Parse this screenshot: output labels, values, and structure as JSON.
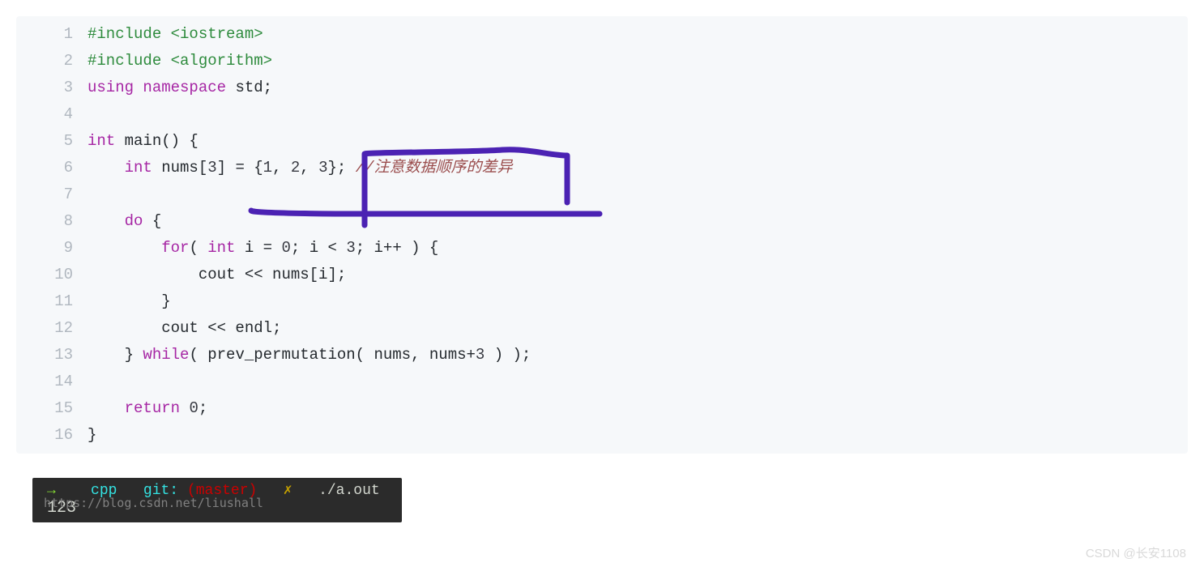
{
  "code": {
    "lines": [
      {
        "n": "1",
        "segs": [
          {
            "cls": "preproc",
            "t": "#include <iostream>"
          }
        ]
      },
      {
        "n": "2",
        "segs": [
          {
            "cls": "preproc",
            "t": "#include <algorithm>"
          }
        ]
      },
      {
        "n": "3",
        "segs": [
          {
            "cls": "kw",
            "t": "using"
          },
          {
            "cls": "",
            "t": " "
          },
          {
            "cls": "kw",
            "t": "namespace"
          },
          {
            "cls": "",
            "t": " std;"
          }
        ]
      },
      {
        "n": "4",
        "segs": [
          {
            "cls": "",
            "t": ""
          }
        ]
      },
      {
        "n": "5",
        "segs": [
          {
            "cls": "type",
            "t": "int"
          },
          {
            "cls": "",
            "t": " main() {"
          }
        ]
      },
      {
        "n": "6",
        "segs": [
          {
            "cls": "",
            "t": "    "
          },
          {
            "cls": "type",
            "t": "int"
          },
          {
            "cls": "",
            "t": " nums["
          },
          {
            "cls": "num",
            "t": "3"
          },
          {
            "cls": "",
            "t": "] = {"
          },
          {
            "cls": "num",
            "t": "1"
          },
          {
            "cls": "",
            "t": ", "
          },
          {
            "cls": "num",
            "t": "2"
          },
          {
            "cls": "",
            "t": ", "
          },
          {
            "cls": "num",
            "t": "3"
          },
          {
            "cls": "",
            "t": "}; "
          },
          {
            "cls": "cmt",
            "t": "//注意数据顺序的差异"
          }
        ]
      },
      {
        "n": "7",
        "segs": [
          {
            "cls": "",
            "t": ""
          }
        ]
      },
      {
        "n": "8",
        "segs": [
          {
            "cls": "",
            "t": "    "
          },
          {
            "cls": "kw",
            "t": "do"
          },
          {
            "cls": "",
            "t": " {"
          }
        ]
      },
      {
        "n": "9",
        "segs": [
          {
            "cls": "",
            "t": "        "
          },
          {
            "cls": "kw",
            "t": "for"
          },
          {
            "cls": "",
            "t": "( "
          },
          {
            "cls": "type",
            "t": "int"
          },
          {
            "cls": "",
            "t": " i = "
          },
          {
            "cls": "num",
            "t": "0"
          },
          {
            "cls": "",
            "t": "; i < "
          },
          {
            "cls": "num",
            "t": "3"
          },
          {
            "cls": "",
            "t": "; i++ ) {"
          }
        ]
      },
      {
        "n": "10",
        "segs": [
          {
            "cls": "",
            "t": "            cout << nums[i];"
          }
        ]
      },
      {
        "n": "11",
        "segs": [
          {
            "cls": "",
            "t": "        }"
          }
        ]
      },
      {
        "n": "12",
        "segs": [
          {
            "cls": "",
            "t": "        cout << endl;"
          }
        ]
      },
      {
        "n": "13",
        "segs": [
          {
            "cls": "",
            "t": "    } "
          },
          {
            "cls": "kw",
            "t": "while"
          },
          {
            "cls": "",
            "t": "( prev_permutation( nums, nums+"
          },
          {
            "cls": "num",
            "t": "3"
          },
          {
            "cls": "",
            "t": " ) );"
          }
        ]
      },
      {
        "n": "14",
        "segs": [
          {
            "cls": "",
            "t": ""
          }
        ]
      },
      {
        "n": "15",
        "segs": [
          {
            "cls": "",
            "t": "    "
          },
          {
            "cls": "kw",
            "t": "return"
          },
          {
            "cls": "",
            "t": " "
          },
          {
            "cls": "num",
            "t": "0"
          },
          {
            "cls": "",
            "t": ";"
          }
        ]
      },
      {
        "n": "16",
        "segs": [
          {
            "cls": "",
            "t": "}"
          }
        ]
      }
    ]
  },
  "terminal": {
    "arrow": "→",
    "dir": "cpp",
    "git_label": "git:",
    "branch": "(master)",
    "x": "✗",
    "cmd": "./a.out",
    "watermark": "https://blog.csdn.net/liushall",
    "output": "123"
  },
  "page_watermark": "CSDN @长安1108",
  "annotation_color": "#4b22b3"
}
